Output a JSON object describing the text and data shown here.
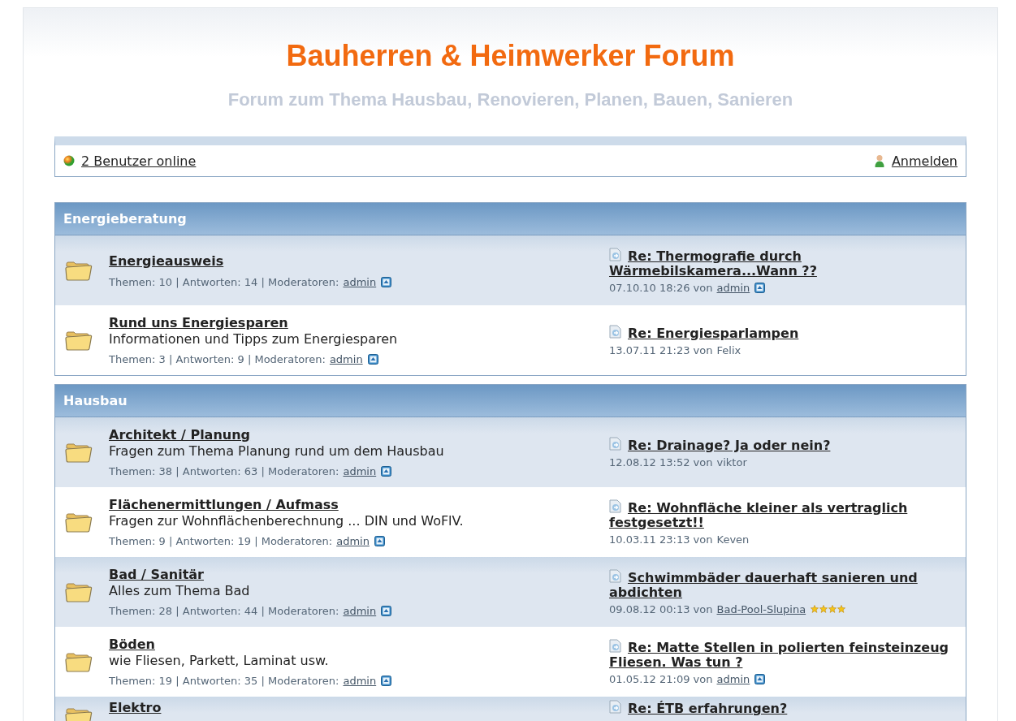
{
  "header": {
    "title": "Bauherren & Heimwerker Forum",
    "subtitle": "Forum zum Thema Hausbau, Renovieren, Planen, Bauen, Sanieren"
  },
  "userbar": {
    "online": "2 Benutzer online",
    "login": "Anmelden"
  },
  "sections": [
    {
      "title": "Energieberatung",
      "forums": [
        {
          "title": "Energieausweis",
          "stats": "Themen: 10 | Antworten: 14 | Moderatoren:",
          "moderator": "admin",
          "last_post": {
            "title": "Re: Thermografie durch Wärmebilskamera...Wann ??",
            "meta": "07.10.10 18:26 von",
            "author": "admin",
            "author_link": true,
            "profile_icon": true
          }
        },
        {
          "title": "Rund uns Energiesparen",
          "description": "Informationen und Tipps zum Energiesparen",
          "stats": "Themen: 3 | Antworten: 9 | Moderatoren:",
          "moderator": "admin",
          "last_post": {
            "title": "Re: Energiesparlampen",
            "meta": "13.07.11 21:23 von",
            "author": "Felix",
            "author_link": false,
            "profile_icon": false
          }
        }
      ]
    },
    {
      "title": "Hausbau",
      "forums": [
        {
          "title": "Architekt / Planung",
          "description": "Fragen zum Thema Planung rund um dem Hausbau",
          "stats": "Themen: 38 | Antworten: 63 | Moderatoren:",
          "moderator": "admin",
          "last_post": {
            "title": "Re: Drainage? Ja oder nein?",
            "meta": "12.08.12 13:52 von",
            "author": "viktor",
            "author_link": false,
            "profile_icon": false
          }
        },
        {
          "title": "Flächenermittlungen / Aufmass",
          "description": "Fragen zur Wohnflächenberechnung ... DIN und WoFlV.",
          "stats": "Themen: 9 | Antworten: 19 | Moderatoren:",
          "moderator": "admin",
          "last_post": {
            "title": "Re: Wohnfläche kleiner als vertraglich festgesetzt!!",
            "meta": "10.03.11 23:13 von",
            "author": "Keven",
            "author_link": false,
            "profile_icon": false
          }
        },
        {
          "title": "Bad / Sanitär",
          "description": "Alles zum Thema Bad",
          "stats": "Themen: 28 | Antworten: 44 | Moderatoren:",
          "moderator": "admin",
          "last_post": {
            "title": "Schwimmbäder dauerhaft sanieren und abdichten",
            "meta": "09.08.12 00:13 von",
            "author": "Bad-Pool-Slupina",
            "author_link": true,
            "profile_icon": false,
            "stars": 4
          }
        },
        {
          "title": "Böden",
          "description": "wie Fliesen, Parkett, Laminat usw.",
          "stats": "Themen: 19 | Antworten: 35 | Moderatoren:",
          "moderator": "admin",
          "last_post": {
            "title": "Re: Matte Stellen in polierten feinsteinzeug Fliesen. Was tun ?",
            "meta": "01.05.12 21:09 von",
            "author": "admin",
            "author_link": true,
            "profile_icon": true
          }
        },
        {
          "title": "Elektro",
          "last_post": {
            "title": "Re: ÉTB erfahrungen?"
          }
        }
      ]
    }
  ]
}
